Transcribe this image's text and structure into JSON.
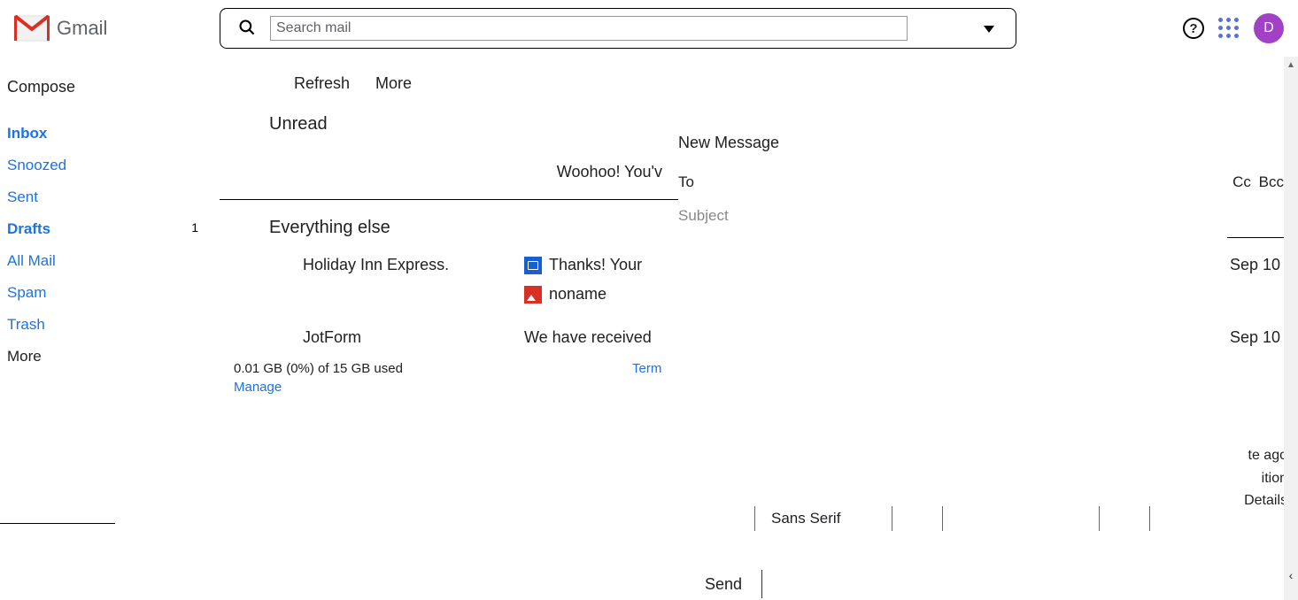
{
  "header": {
    "app_name": "Gmail",
    "search_placeholder": "Search mail",
    "avatar_letter": "D"
  },
  "sidebar": {
    "compose": "Compose",
    "items": [
      {
        "label": "Inbox",
        "bold": true
      },
      {
        "label": "Snoozed"
      },
      {
        "label": "Sent"
      },
      {
        "label": "Drafts",
        "bold": true,
        "count": "1"
      },
      {
        "label": "All Mail"
      },
      {
        "label": "Spam"
      },
      {
        "label": "Trash"
      }
    ],
    "more": "More"
  },
  "toolbar": {
    "refresh": "Refresh",
    "more": "More"
  },
  "sections": {
    "unread": "Unread",
    "unread_empty": "Woohoo! You'v",
    "else": "Everything else"
  },
  "mails": [
    {
      "sender": "Holiday Inn Express.",
      "subject": "Thanks! Your",
      "attachment": "noname",
      "date": "Sep 10"
    },
    {
      "sender": "JotForm",
      "subject": "We have received",
      "date": "Sep 10"
    }
  ],
  "footer": {
    "storage": "0.01 GB (0%) of 15 GB used",
    "manage": "Manage",
    "terms": "Term",
    "activity1": "te ago",
    "activity2": "ition",
    "details": "Details"
  },
  "compose_window": {
    "title": "New Message",
    "to": "To",
    "cc": "Cc",
    "bcc": "Bcc",
    "subject": "Subject",
    "font": "Sans Serif",
    "send": "Send"
  }
}
